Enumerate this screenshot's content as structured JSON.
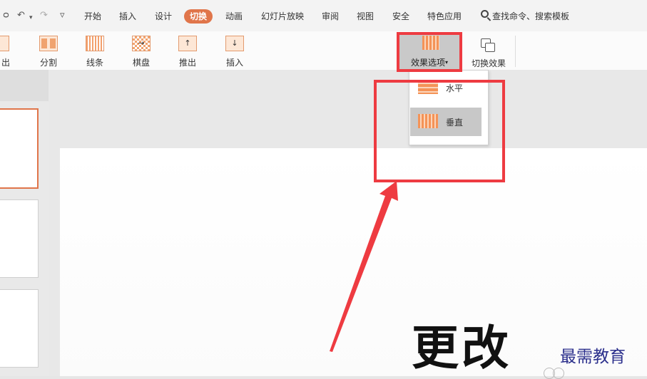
{
  "quick_access": {
    "undo_glyph": "↶",
    "redo_glyph": "↷",
    "more_glyph": "▿",
    "dropdown_glyph": "▾"
  },
  "menu_tabs": [
    {
      "label": "开始"
    },
    {
      "label": "插入"
    },
    {
      "label": "设计"
    },
    {
      "label": "切换",
      "active": true
    },
    {
      "label": "动画"
    },
    {
      "label": "幻灯片放映"
    },
    {
      "label": "审阅"
    },
    {
      "label": "视图"
    },
    {
      "label": "安全"
    },
    {
      "label": "特色应用"
    }
  ],
  "search": {
    "label": "查找命令、搜索模板",
    "icon": "search-icon"
  },
  "ribbon": {
    "partial_label": "出",
    "buttons": [
      {
        "label": "分割",
        "icon": "split-icon"
      },
      {
        "label": "线条",
        "icon": "lines-icon"
      },
      {
        "label": "棋盘",
        "icon": "checkerboard-icon",
        "glyph": "→"
      },
      {
        "label": "推出",
        "icon": "push-icon",
        "glyph": "↑"
      },
      {
        "label": "插入",
        "icon": "cover-icon",
        "glyph": "↓"
      }
    ],
    "effect_options": {
      "label": "效果选项",
      "caret": "▾",
      "icon": "vertical-bars-icon"
    },
    "switch_effect": {
      "label": "切换效果",
      "icon": "switch-effect-icon"
    }
  },
  "effect_dropdown": {
    "items": [
      {
        "label": "水平",
        "icon": "horizontal-bars-icon",
        "selected": false
      },
      {
        "label": "垂直",
        "icon": "vertical-bars-icon",
        "selected": true
      }
    ]
  },
  "slide": {
    "title": "更改"
  },
  "watermark": "最需教育",
  "colors": {
    "accent": "#e0754a",
    "annotation_red": "#ee3b41",
    "icon_orange": "#f49357",
    "watermark_blue": "#2b2f8c"
  }
}
